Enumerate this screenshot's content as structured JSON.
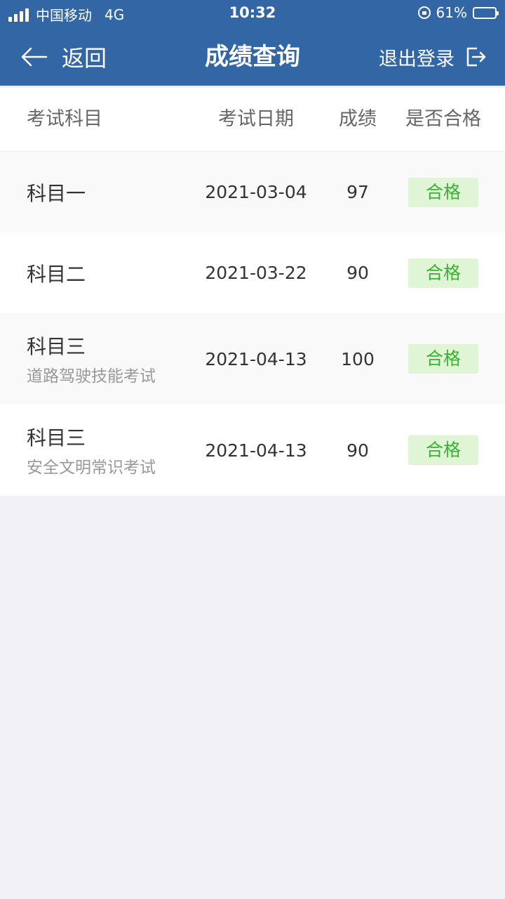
{
  "status_bar": {
    "carrier": "中国移动",
    "network": "4G",
    "time": "10:32",
    "battery_percent": "61%",
    "battery_level": 0.61
  },
  "nav": {
    "back_label": "返回",
    "title": "成绩查询",
    "logout_label": "退出登录"
  },
  "table": {
    "headers": {
      "subject": "考试科目",
      "date": "考试日期",
      "score": "成绩",
      "pass": "是否合格"
    },
    "rows": [
      {
        "subject": "科目一",
        "subtitle": "",
        "date": "2021-03-04",
        "score": "97",
        "pass": "合格"
      },
      {
        "subject": "科目二",
        "subtitle": "",
        "date": "2021-03-22",
        "score": "90",
        "pass": "合格"
      },
      {
        "subject": "科目三",
        "subtitle": "道路驾驶技能考试",
        "date": "2021-04-13",
        "score": "100",
        "pass": "合格"
      },
      {
        "subject": "科目三",
        "subtitle": "安全文明常识考试",
        "date": "2021-04-13",
        "score": "90",
        "pass": "合格"
      }
    ]
  },
  "colors": {
    "header_blue": "#3366a4",
    "pass_bg": "#dff5d6",
    "pass_text": "#3cb034",
    "page_bg": "#f1f1f6"
  }
}
